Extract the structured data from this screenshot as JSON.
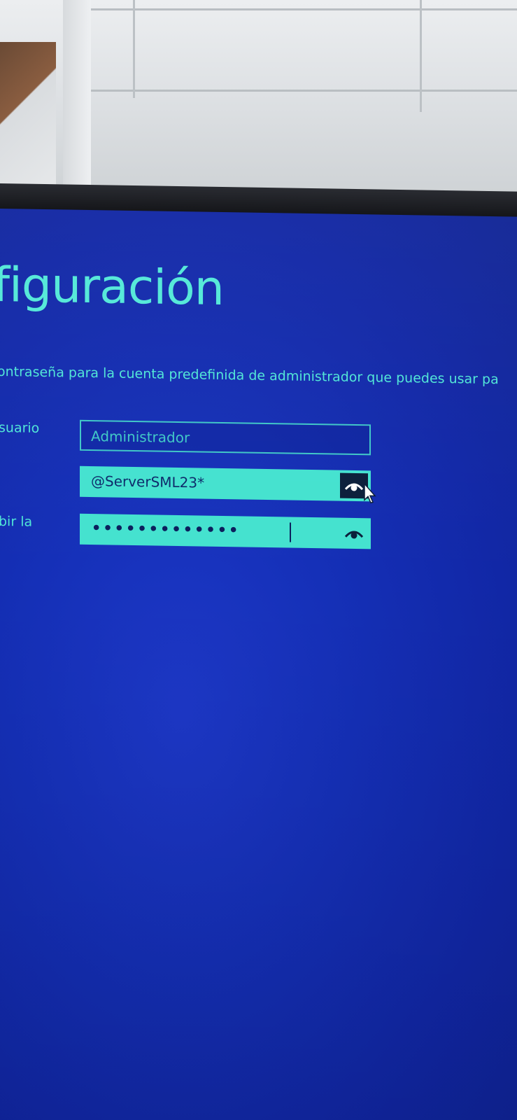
{
  "screen": {
    "title": "nfiguración",
    "description": "ontraseña para la cuenta predefinida de administrador que puedes usar pa"
  },
  "form": {
    "username": {
      "label": "suario",
      "value": "Administrador"
    },
    "password": {
      "value": "@ServerSML23*",
      "reveal_icon": "eye-icon"
    },
    "confirm": {
      "label": "bir la",
      "masked_value": "•••••••••••••",
      "reveal_icon": "eye-icon"
    }
  },
  "colors": {
    "screen_blue": "#1530b8",
    "accent_teal": "#4fe6d6",
    "field_fill": "#44e2cf"
  }
}
